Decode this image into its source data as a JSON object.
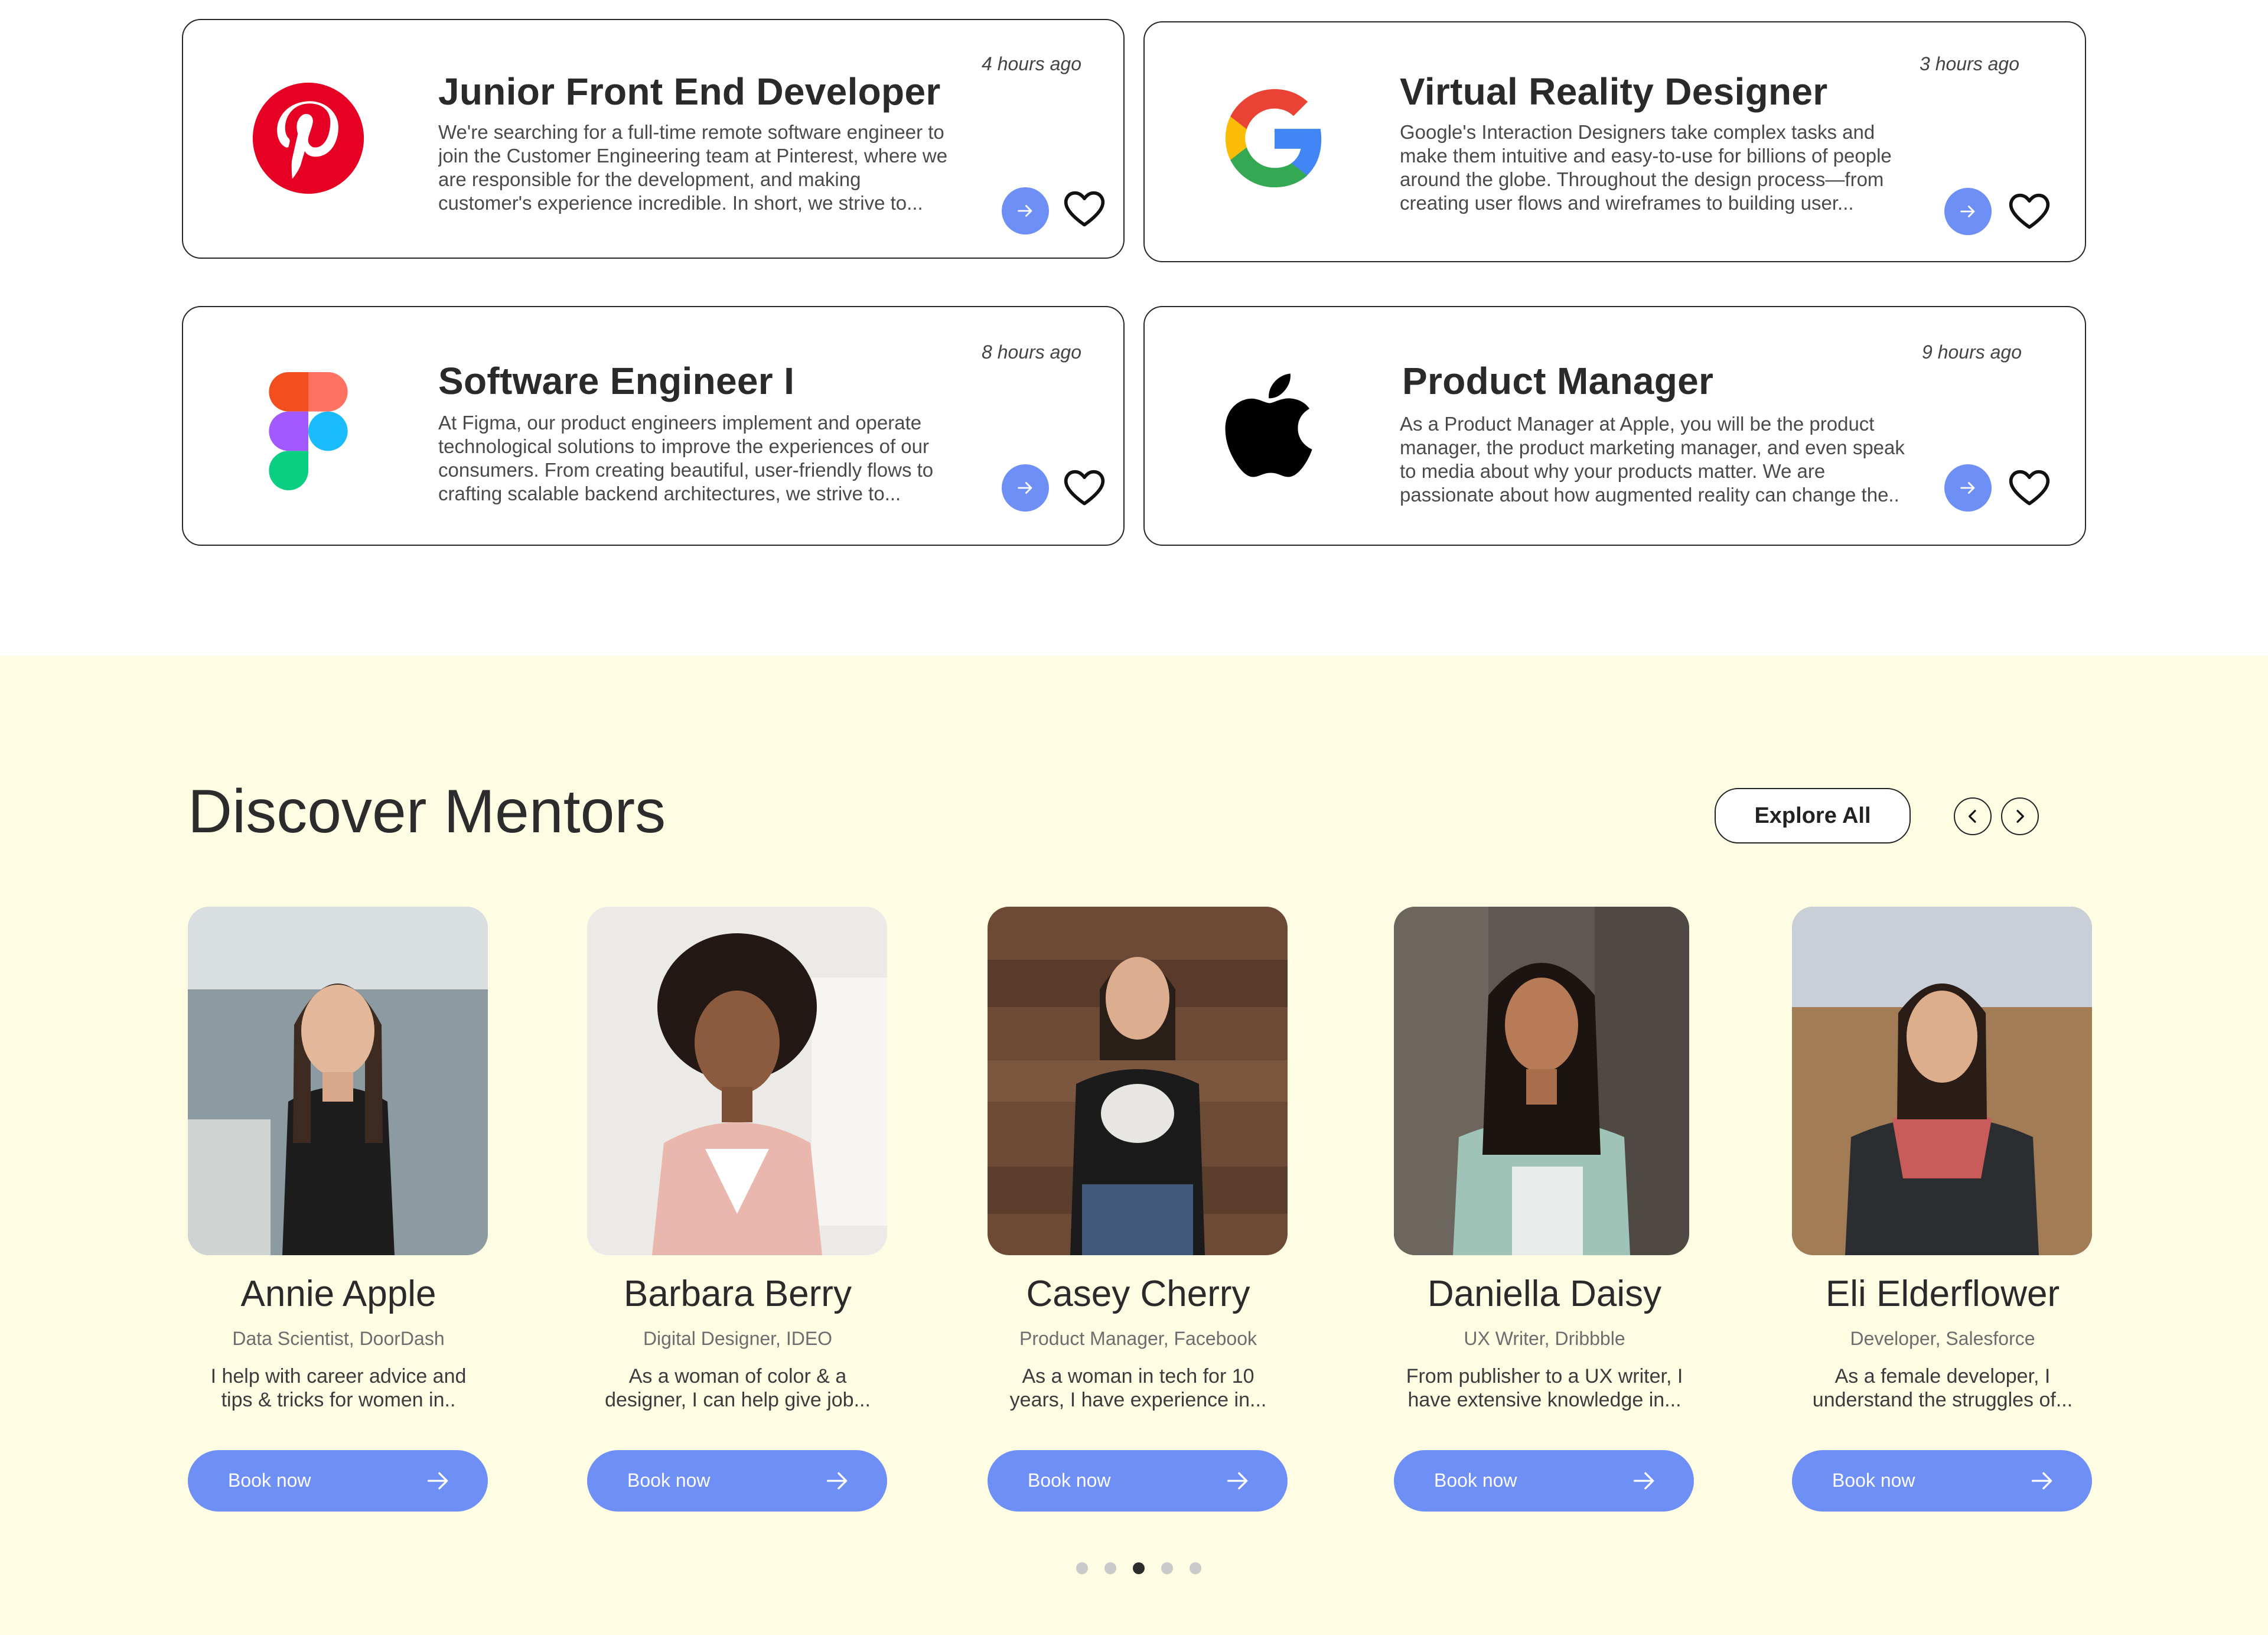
{
  "jobs": [
    {
      "company": "Pinterest",
      "logo": "pinterest-logo",
      "title": "Junior Front End Developer",
      "time": "4 hours ago",
      "description": "We're searching for a full-time remote software engineer to join the Customer Engineering team at Pinterest, where we are responsible for the development, and making customer's experience incredible. In short, we strive to..."
    },
    {
      "company": "Google",
      "logo": "google-logo",
      "title": "Virtual Reality Designer",
      "time": "3 hours ago",
      "description": "Google's Interaction Designers take complex tasks and make them intuitive and easy-to-use for billions of people around the globe. Throughout the design process—from creating user flows and wireframes to building user..."
    },
    {
      "company": "Figma",
      "logo": "figma-logo",
      "title": "Software Engineer I",
      "time": "8 hours ago",
      "description": "At Figma, our product engineers implement and operate technological solutions to improve the experiences of our consumers. From creating beautiful, user-friendly flows to crafting scalable backend architectures, we strive to..."
    },
    {
      "company": "Apple",
      "logo": "apple-logo",
      "title": "Product Manager",
      "time": "9 hours ago",
      "description": "As a Product Manager at Apple, you will be the product manager, the product marketing manager, and even speak to media about why your products matter. We are passionate about how augmented reality can change the.."
    }
  ],
  "mentors_section": {
    "title": "Discover Mentors",
    "explore_label": "Explore All",
    "prev_icon": "chevron-left-icon",
    "next_icon": "chevron-right-icon",
    "book_label": "Book now",
    "pagination": {
      "count": 5,
      "active": 3
    }
  },
  "mentors": [
    {
      "name": "Annie Apple",
      "role": "Data Scientist, DoorDash",
      "bio": "I help with career advice and tips & tricks for women in.."
    },
    {
      "name": "Barbara Berry",
      "role": "Digital Designer, IDEO",
      "bio": "As a woman of color & a designer, I can help give job..."
    },
    {
      "name": "Casey Cherry",
      "role": "Product Manager, Facebook",
      "bio": "As a woman in tech for 10 years, I have experience in..."
    },
    {
      "name": "Daniella Daisy",
      "role": "UX Writer, Dribbble",
      "bio": "From publisher to a UX writer, I have extensive knowledge in..."
    },
    {
      "name": "Eli Elderflower",
      "role": "Developer, Salesforce",
      "bio": "As a female developer, I understand the struggles of..."
    }
  ],
  "colors": {
    "accent": "#6e8ff5",
    "mentors_bg": "#fefce3",
    "text": "#2b2b2b"
  }
}
